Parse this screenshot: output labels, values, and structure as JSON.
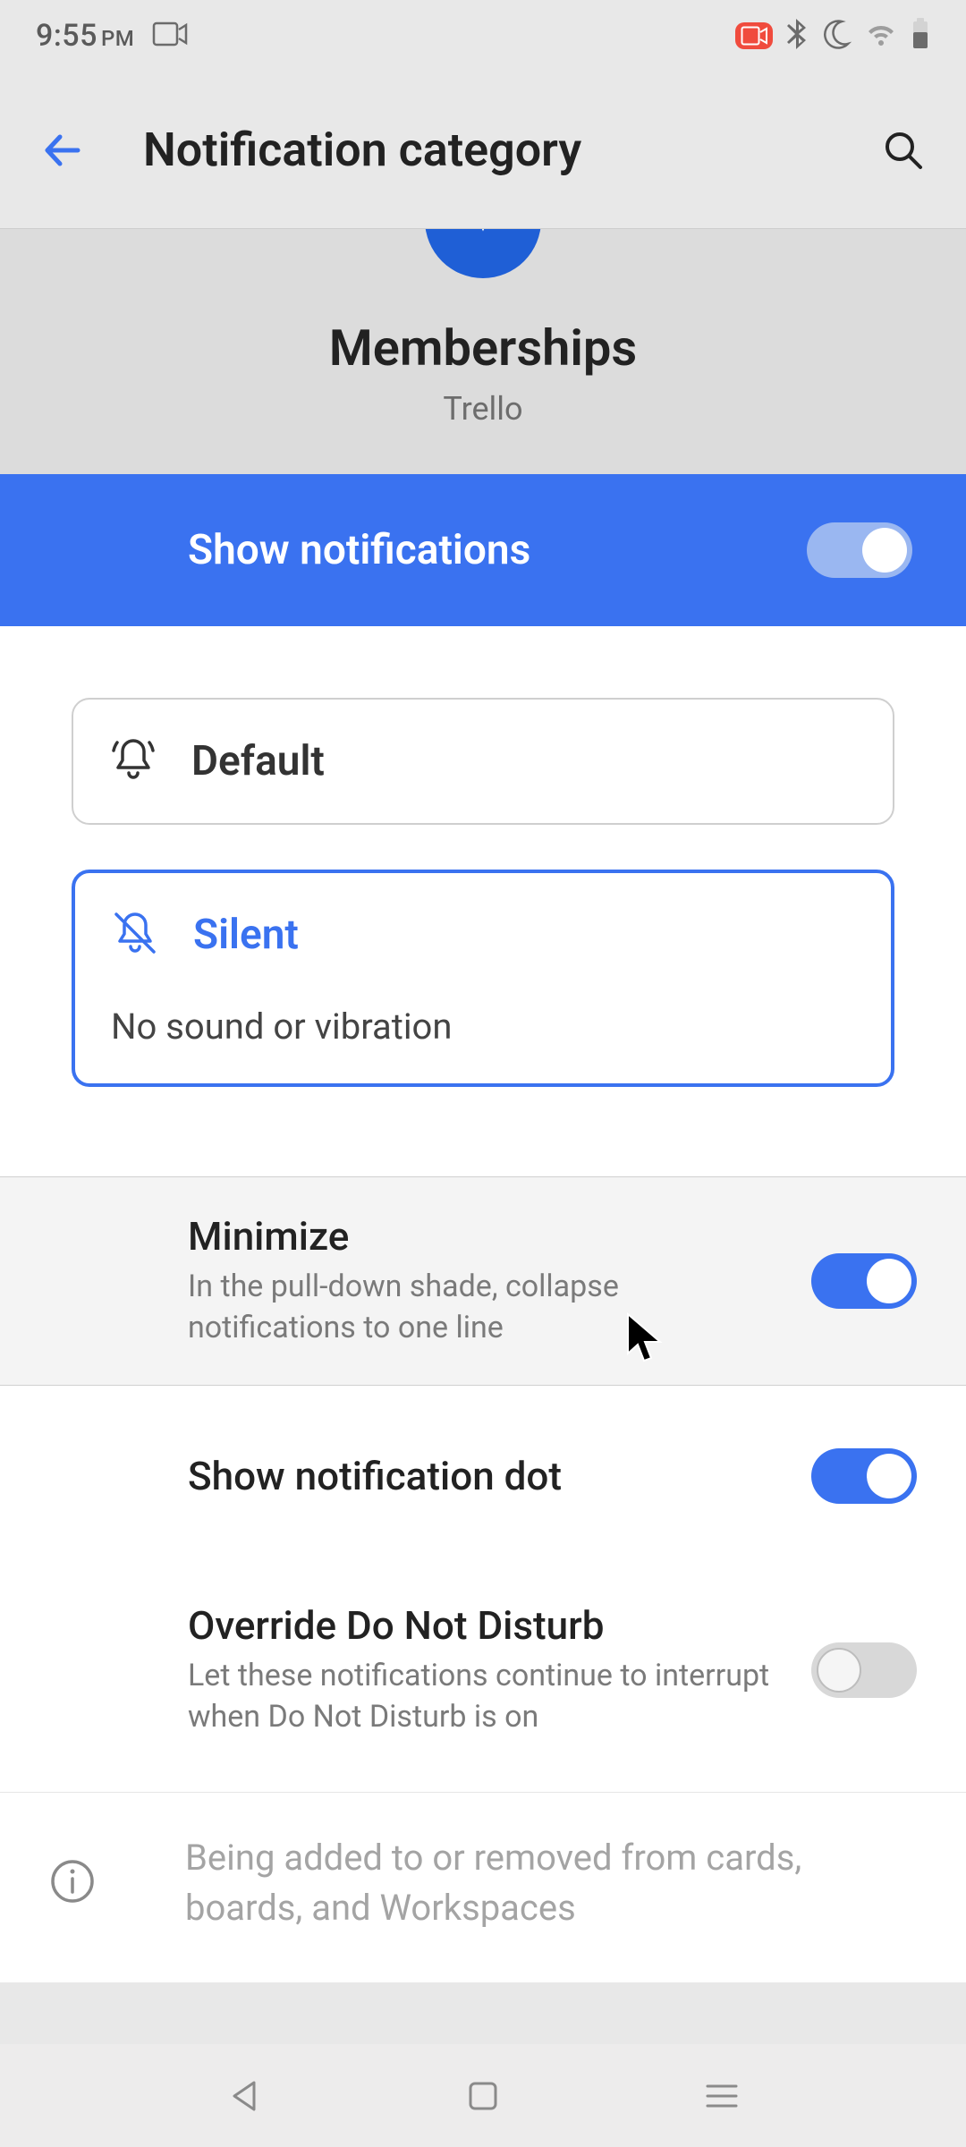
{
  "status": {
    "time": "9:55",
    "ampm": "PM"
  },
  "appbar": {
    "title": "Notification category"
  },
  "category": {
    "name": "Memberships",
    "app": "Trello"
  },
  "showNotifications": {
    "label": "Show notifications",
    "enabled": true
  },
  "modes": {
    "default": {
      "label": "Default"
    },
    "silent": {
      "label": "Silent",
      "desc": "No sound or vibration"
    }
  },
  "settings": {
    "minimize": {
      "title": "Minimize",
      "desc": "In the pull-down shade, collapse notifications to one line",
      "enabled": true
    },
    "dot": {
      "title": "Show notification dot",
      "enabled": true
    },
    "dnd": {
      "title": "Override Do Not Disturb",
      "desc": "Let these notifications continue to interrupt when Do Not Disturb is on",
      "enabled": false
    }
  },
  "info": {
    "text": "Being added to or removed from cards, boards, and Workspaces"
  }
}
